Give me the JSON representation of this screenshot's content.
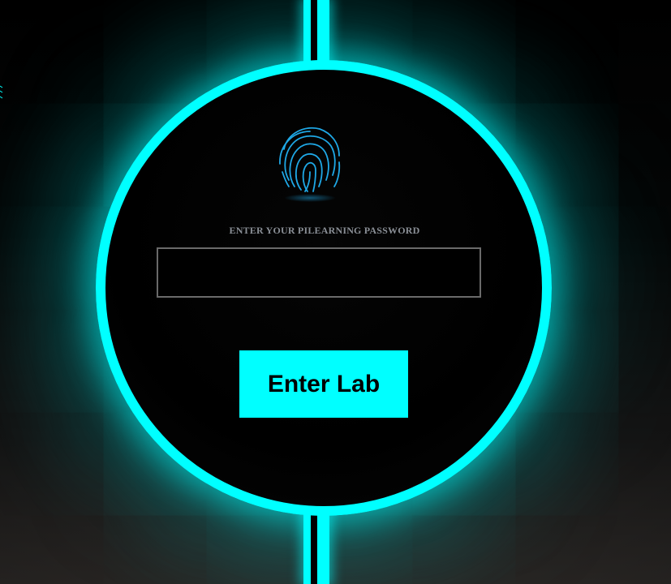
{
  "login": {
    "password_label": "ENTER YOUR PILEARNING PASSWORD",
    "password_value": "",
    "password_placeholder": "",
    "enter_button_label": "Enter Lab"
  },
  "icons": {
    "fingerprint": "fingerprint-icon"
  },
  "colors": {
    "accent": "#00ffff",
    "background": "#000000",
    "label": "#8a8f96",
    "fingerprint": "#1fa8e6"
  }
}
